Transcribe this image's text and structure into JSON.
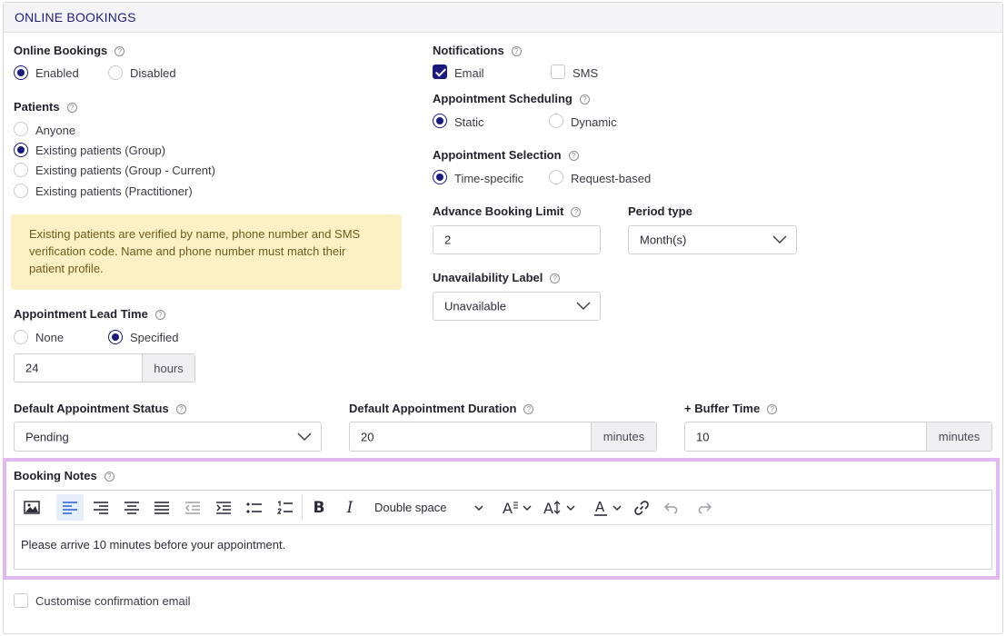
{
  "header": {
    "title": "ONLINE BOOKINGS"
  },
  "help_glyph": "?",
  "online_bookings": {
    "label": "Online Bookings",
    "options": [
      "Enabled",
      "Disabled"
    ],
    "selected": "Enabled"
  },
  "patients": {
    "label": "Patients",
    "options": [
      "Anyone",
      "Existing patients (Group)",
      "Existing patients (Group - Current)",
      "Existing patients (Practitioner)"
    ],
    "selected": "Existing patients (Group)"
  },
  "info_box": {
    "text": "Existing patients are verified by name, phone number and SMS verification code. Name and phone number must match their patient profile."
  },
  "lead_time": {
    "label": "Appointment Lead Time",
    "options": [
      "None",
      "Specified"
    ],
    "selected": "Specified",
    "value": "24",
    "unit": "hours"
  },
  "notifications": {
    "label": "Notifications",
    "options": [
      "Email",
      "SMS"
    ],
    "checked": [
      "Email"
    ]
  },
  "scheduling": {
    "label": "Appointment Scheduling",
    "options": [
      "Static",
      "Dynamic"
    ],
    "selected": "Static"
  },
  "selection": {
    "label": "Appointment Selection",
    "options": [
      "Time-specific",
      "Request-based"
    ],
    "selected": "Time-specific"
  },
  "advance_limit": {
    "label": "Advance Booking Limit",
    "value": "2"
  },
  "period_type": {
    "label": "Period type",
    "value": "Month(s)"
  },
  "unavailability": {
    "label": "Unavailability Label",
    "value": "Unavailable"
  },
  "default_status": {
    "label": "Default Appointment Status",
    "value": "Pending"
  },
  "default_duration": {
    "label": "Default Appointment Duration",
    "value": "20",
    "unit": "minutes"
  },
  "buffer_time": {
    "label": "+ Buffer Time",
    "value": "10",
    "unit": "minutes"
  },
  "booking_notes": {
    "label": "Booking Notes",
    "line_spacing": "Double space",
    "content": "Please arrive 10 minutes before your appointment."
  },
  "confirmation_email": {
    "label": "Customise confirmation email",
    "checked": false
  },
  "colors": {
    "accent": "#1a1a7e",
    "highlight_border": "#e3b7f0",
    "info_bg": "#fdf0c4"
  }
}
